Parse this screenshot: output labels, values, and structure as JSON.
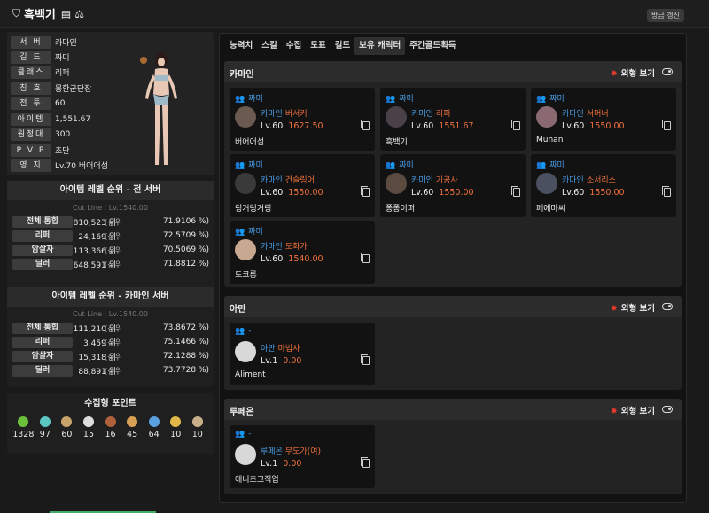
{
  "header": {
    "name": "흑백기",
    "refresh_label": "방금 갱신"
  },
  "profile": {
    "rows": [
      {
        "label": "서 버",
        "value": "카마인"
      },
      {
        "label": "길 드",
        "value": "짜미"
      },
      {
        "label": "클래스",
        "value": "리퍼"
      },
      {
        "label": "칭 호",
        "value": "몽환군단장"
      },
      {
        "label": "전 투",
        "value": "60"
      },
      {
        "label": "아이템",
        "value": "1,551.67"
      },
      {
        "label": "원정대",
        "value": "300"
      },
      {
        "label": "P V P",
        "value": "초단"
      },
      {
        "label": "영 지",
        "value": "Lv.70 버어어섬"
      }
    ]
  },
  "rank_all": {
    "title": "아이템 레벨 순위 - 전 서버",
    "cutline": "Cut Line : Lv.1540.00",
    "rows": [
      {
        "label": "전체 통합",
        "rank": "810,523 위",
        "wi": "(상위",
        "pct": "71.9106 %)"
      },
      {
        "label": "리퍼",
        "rank": "24,169 위",
        "wi": "(상위",
        "pct": "72.5709 %)"
      },
      {
        "label": "암살자",
        "rank": "113,366 위",
        "wi": "(상위",
        "pct": "70.5069 %)"
      },
      {
        "label": "딜러",
        "rank": "648,591 위",
        "wi": "(상위",
        "pct": "71.8812 %)"
      }
    ]
  },
  "rank_server": {
    "title": "아이템 레벨 순위 - 카마인 서버",
    "cutline": "Cut Line : Lv.1540.00",
    "rows": [
      {
        "label": "전체 통합",
        "rank": "111,210 위",
        "wi": "(상위",
        "pct": "73.8672 %)"
      },
      {
        "label": "리퍼",
        "rank": "3,459 위",
        "wi": "(상위",
        "pct": "75.1466 %)"
      },
      {
        "label": "암살자",
        "rank": "15,318 위",
        "wi": "(상위",
        "pct": "72.1288 %)"
      },
      {
        "label": "딜러",
        "rank": "88,891 위",
        "wi": "(상위",
        "pct": "73.7728 %)"
      }
    ]
  },
  "collect": {
    "title": "수집형 포인트",
    "items": [
      {
        "icon": "mokoko-seed-icon",
        "value": "1328",
        "color": "#6bbf3a"
      },
      {
        "icon": "island-heart-icon",
        "value": "97",
        "color": "#5ac7c0"
      },
      {
        "icon": "masterpiece-icon",
        "value": "60",
        "color": "#c9a46a"
      },
      {
        "icon": "giant-heart-icon",
        "value": "15",
        "color": "#ddd"
      },
      {
        "icon": "ignea-token-icon",
        "value": "16",
        "color": "#b0603a"
      },
      {
        "icon": "adventure-tome-icon",
        "value": "45",
        "color": "#d9a055"
      },
      {
        "icon": "voyage-icon",
        "value": "64",
        "color": "#5aa0e0"
      },
      {
        "icon": "world-tree-leaf-icon",
        "value": "10",
        "color": "#e0b84a"
      },
      {
        "icon": "orpheus-star-icon",
        "value": "10",
        "color": "#c9b08a"
      }
    ]
  },
  "tabs": [
    "능력치",
    "스킬",
    "수집",
    "도표",
    "길드",
    "보유 캐릭터",
    "주간골드획득"
  ],
  "active_tab": "보유 캐릭터",
  "look_label": "외형 보기",
  "servers": [
    {
      "name": "카마인",
      "cards": [
        {
          "guild": "짜미",
          "server": "카마인",
          "class": "버서커",
          "lv": "Lv.60",
          "ilvl": "1627.50",
          "name": "버어어섬"
        },
        {
          "guild": "짜미",
          "server": "카마인",
          "class": "리퍼",
          "lv": "Lv.60",
          "ilvl": "1551.67",
          "name": "흑백기"
        },
        {
          "guild": "짜미",
          "server": "카마인",
          "class": "서머너",
          "lv": "Lv.60",
          "ilvl": "1550.00",
          "name": "Munan"
        },
        {
          "guild": "짜미",
          "server": "카마인",
          "class": "건슬링어",
          "lv": "Lv.60",
          "ilvl": "1550.00",
          "name": "링거링거링"
        },
        {
          "guild": "짜미",
          "server": "카마인",
          "class": "기공사",
          "lv": "Lv.60",
          "ilvl": "1550.00",
          "name": "퐁퐁이퍼"
        },
        {
          "guild": "짜미",
          "server": "카마인",
          "class": "소서리스",
          "lv": "Lv.60",
          "ilvl": "1550.00",
          "name": "페에마씨"
        },
        {
          "guild": "짜미",
          "server": "카마인",
          "class": "도화가",
          "lv": "Lv.60",
          "ilvl": "1540.00",
          "name": "도코롱"
        }
      ]
    },
    {
      "name": "아만",
      "cards": [
        {
          "guild": "-",
          "server": "아만",
          "class": "마법사",
          "lv": "Lv.1",
          "ilvl": "0.00",
          "name": "Aliment"
        }
      ]
    },
    {
      "name": "루페온",
      "cards": [
        {
          "guild": "-",
          "server": "루페온",
          "class": "무도가(여)",
          "lv": "Lv.1",
          "ilvl": "0.00",
          "name": "애니츠그직업"
        }
      ]
    }
  ]
}
